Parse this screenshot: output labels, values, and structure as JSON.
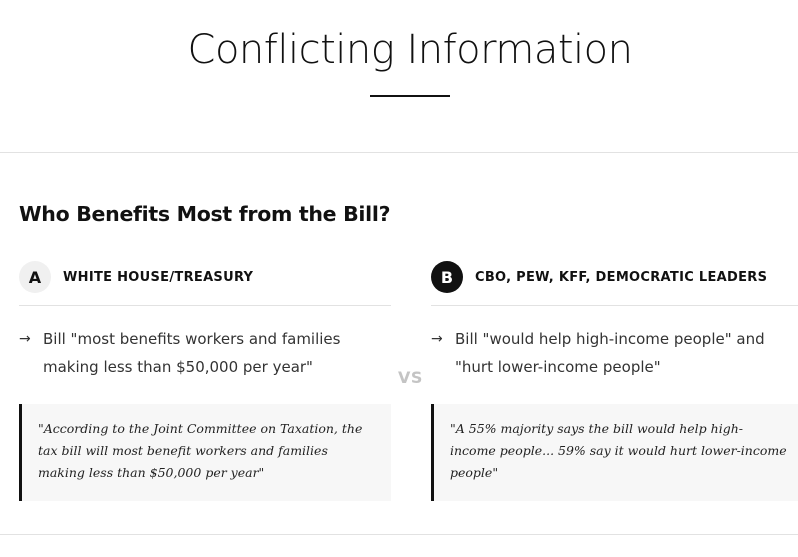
{
  "page": {
    "title": "Conflicting Information"
  },
  "section": {
    "title": "Who Benefits Most from the Bill?",
    "vs_label": "VS"
  },
  "sources": [
    {
      "badge": "A",
      "name": "WHITE HOUSE/TREASURY",
      "claim": "Bill \"most benefits workers and families making less than $50,000 per year\"",
      "quote": "\"According to the Joint Committee on Taxation, the tax bill will most benefit workers and families making less than $50,000 per year\""
    },
    {
      "badge": "B",
      "name": "CBO, PEW, KFF, DEMOCRATIC LEADERS",
      "claim": "Bill \"would help high-income people\" and \"hurt lower-income people\"",
      "quote": "\"A 55% majority says the bill would help high-income people... 59% say it would hurt lower-income people\""
    }
  ],
  "icons": {
    "arrow": "right-arrow-icon"
  }
}
